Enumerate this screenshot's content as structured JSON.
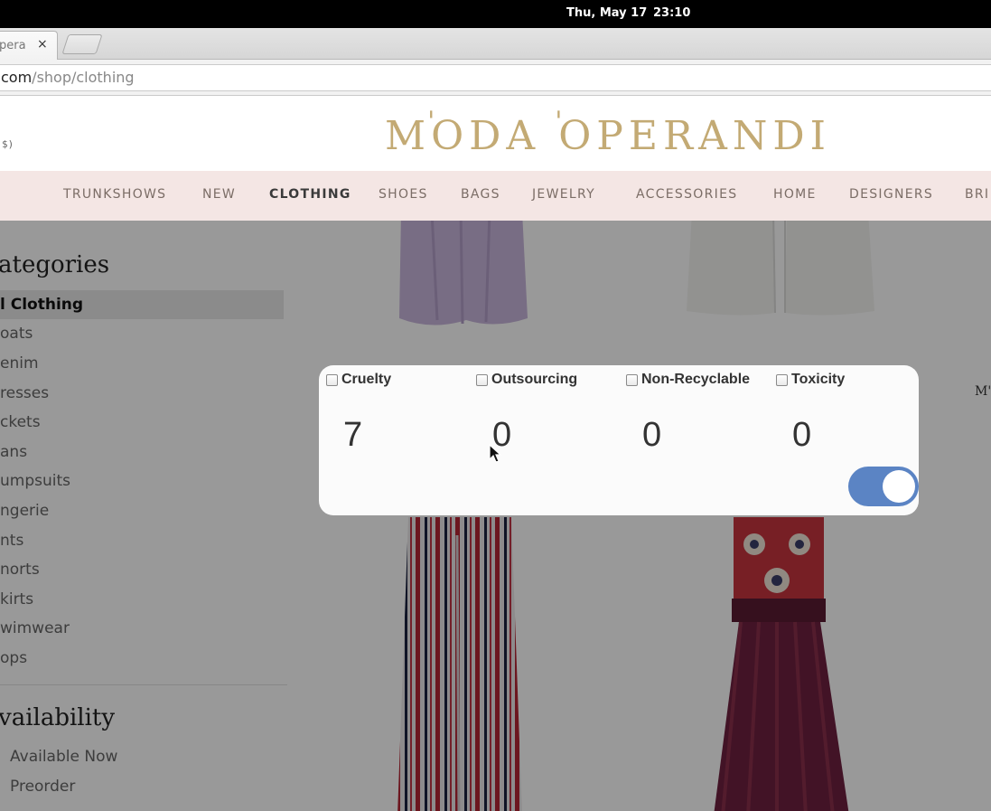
{
  "os": {
    "date": "Thu, May 17",
    "time": "23:10"
  },
  "browser": {
    "tab_title": "pera",
    "tab_close": "×",
    "url_domain": "com",
    "url_path": "/shop/clothing"
  },
  "header": {
    "currency": "$)",
    "logo": "MODA OPERANDI"
  },
  "nav": {
    "items": [
      "TRUNKSHOWS",
      "NEW",
      "CLOTHING",
      "SHOES",
      "BAGS",
      "JEWELRY",
      "ACCESSORIES",
      "HOME",
      "DESIGNERS",
      "BRI"
    ],
    "active": "CLOTHING"
  },
  "sidebar": {
    "categories_heading": "ategories",
    "categories": [
      "l Clothing",
      "oats",
      "enim",
      "resses",
      "ckets",
      "ans",
      "umpsuits",
      "ngerie",
      "nts",
      "norts",
      "kirts",
      "wimwear",
      "ops"
    ],
    "availability_heading": "vailability",
    "availability": [
      "Available Now",
      "Preorder"
    ]
  },
  "side_mark": "M'",
  "panel": {
    "metrics": [
      {
        "label": "Cruelty",
        "value": "7",
        "checked": false
      },
      {
        "label": "Outsourcing",
        "value": "0",
        "checked": false
      },
      {
        "label": "Non-Recyclable",
        "value": "0",
        "checked": false
      },
      {
        "label": "Toxicity",
        "value": "0",
        "checked": false
      }
    ],
    "toggle_on": true,
    "toggle_color": "#5b84c4"
  },
  "colors": {
    "logo_gold": "#c3aa74",
    "nav_bg": "#f4e6e4"
  }
}
